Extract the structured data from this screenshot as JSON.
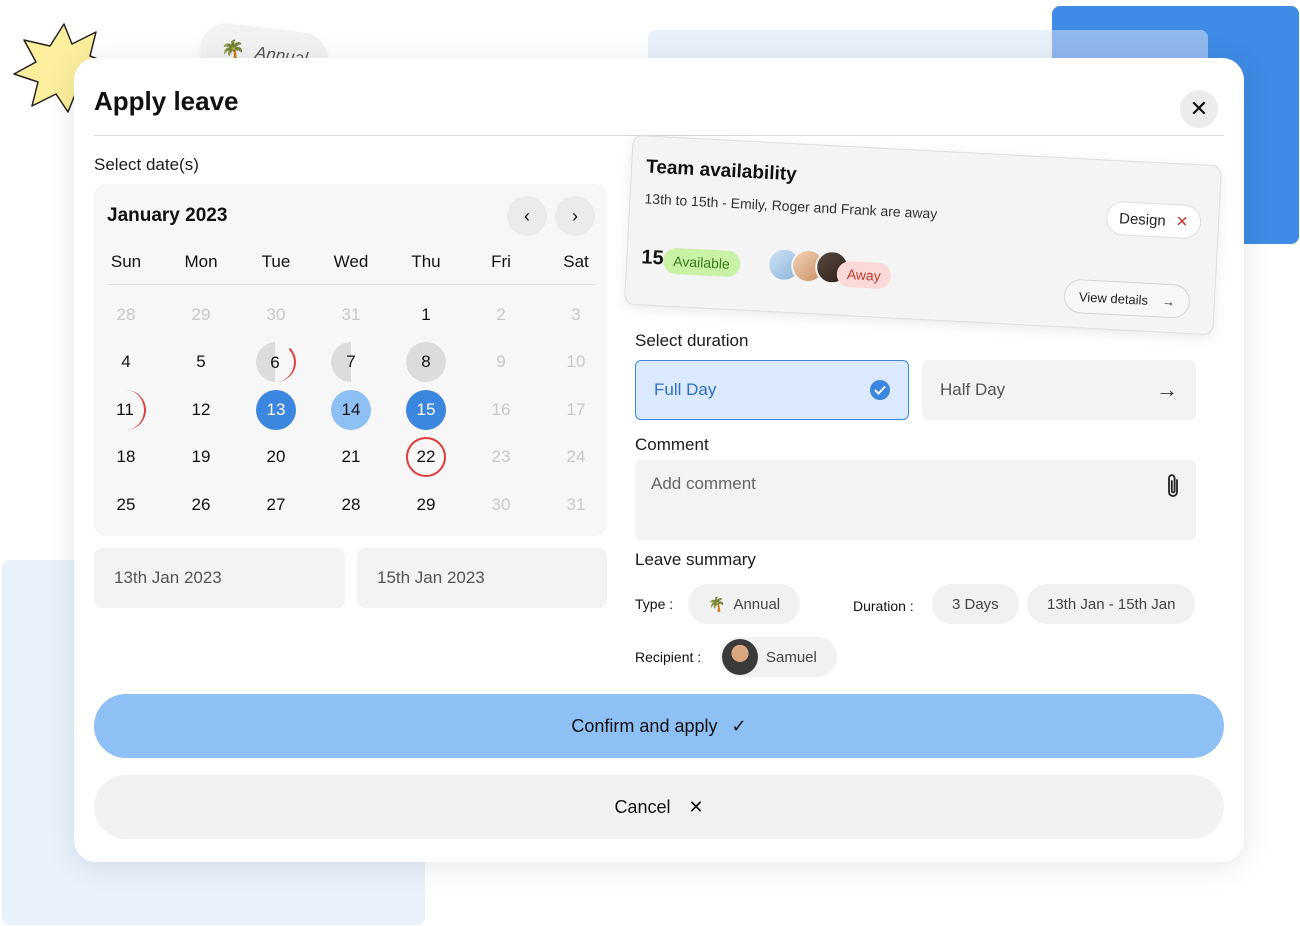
{
  "floating_tag": {
    "label": "Annual",
    "icon": "palm-tree-icon"
  },
  "dialog": {
    "title": "Apply leave",
    "close_icon": "close-icon"
  },
  "dates": {
    "label": "Select date(s)",
    "month": "January 2023",
    "weekdays": [
      "Sun",
      "Mon",
      "Tue",
      "Wed",
      "Thu",
      "Fri",
      "Sat"
    ],
    "weeks": [
      [
        "28",
        "29",
        "30",
        "31",
        "1",
        "2",
        "3"
      ],
      [
        "4",
        "5",
        "6",
        "7",
        "8",
        "9",
        "10"
      ],
      [
        "11",
        "12",
        "13",
        "14",
        "15",
        "16",
        "17"
      ],
      [
        "18",
        "19",
        "20",
        "21",
        "22",
        "23",
        "24"
      ],
      [
        "25",
        "26",
        "27",
        "28",
        "29",
        "30",
        "31"
      ]
    ],
    "start_date": "13th Jan 2023",
    "end_date": "15th Jan 2023"
  },
  "team": {
    "title": "Team availability",
    "subtitle": "13th to 15th - Emily, Roger and Frank are away",
    "filter_tag": "Design",
    "available_count": "15",
    "available_label": "Available",
    "away_label": "Away",
    "view_details": "View details"
  },
  "duration": {
    "label": "Select duration",
    "options": [
      {
        "label": "Full Day",
        "selected": true
      },
      {
        "label": "Half Day",
        "selected": false
      }
    ]
  },
  "comment": {
    "label": "Comment",
    "placeholder": "Add comment"
  },
  "summary": {
    "label": "Leave summary",
    "type_label": "Type :",
    "type_value": "Annual",
    "duration_label": "Duration :",
    "duration_days": "3 Days",
    "duration_range": "13th Jan - 15th Jan",
    "recipient_label": "Recipient :",
    "recipient_name": "Samuel"
  },
  "actions": {
    "confirm": "Confirm and apply",
    "cancel": "Cancel"
  },
  "colors": {
    "accent": "#3b86df",
    "accent_light": "#8ec0f5",
    "danger": "#e03b3b",
    "available": "#c9f2a6",
    "away": "#fbd9d9"
  }
}
